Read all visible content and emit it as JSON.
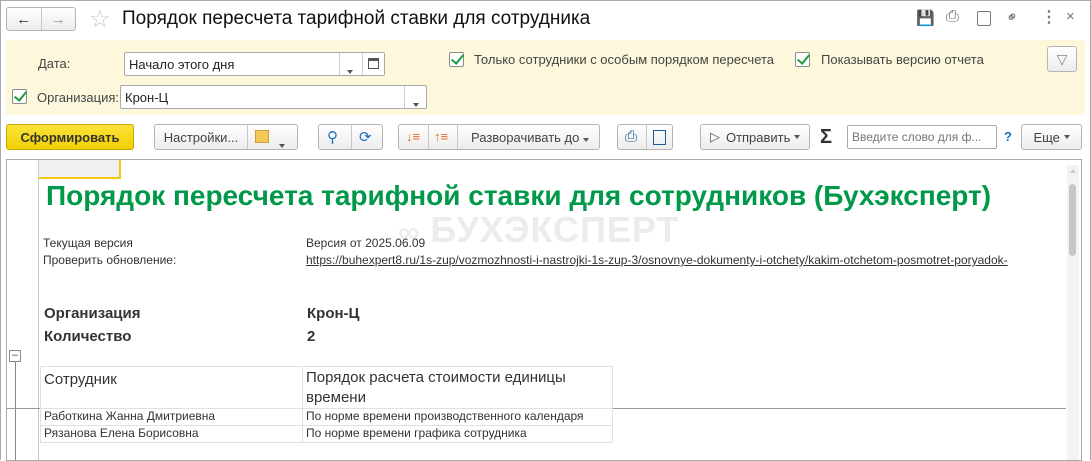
{
  "window": {
    "title": "Порядок пересчета тарифной ставки для сотрудника"
  },
  "filters": {
    "date_label": "Дата:",
    "date_value": "Начало этого дня",
    "org_label": "Организация:",
    "org_value": "Крон-Ц",
    "only_special_label": "Только сотрудники с особым порядком пересчета",
    "show_version_label": "Показывать версию отчета"
  },
  "toolbar": {
    "generate": "Сформировать",
    "settings": "Настройки...",
    "expand_to": "Разворачивать до",
    "send": "Отправить",
    "sigma": "Σ",
    "search_placeholder": "Введите слово для ф...",
    "help": "?",
    "more": "Еще"
  },
  "report": {
    "title": "Порядок пересчета тарифной ставки для сотрудников (Бухэксперт)",
    "watermark": "БУХЭКСПЕРТ",
    "version_label": "Текущая версия",
    "version_value": "Версия от 2025.06.09",
    "update_label": "Проверить обновление:",
    "update_link": "https://buhexpert8.ru/1s-zup/vozmozhnosti-i-nastrojki-1s-zup-3/osnovnye-dokumenty-i-otchety/kakim-otchetom-posmotret-poryadok-",
    "org_label": "Организация",
    "org_value": "Крон-Ц",
    "count_label": "Количество",
    "count_value": "2",
    "columns": [
      "Сотрудник",
      "Порядок расчета стоимости единицы времени"
    ],
    "rows": [
      [
        "Работкина Жанна Дмитриевна",
        "По норме времени производственного календаря"
      ],
      [
        "Рязанова Елена Борисовна",
        "По норме времени графика сотрудника"
      ]
    ]
  },
  "colors": {
    "accent_green": "#00994a",
    "panel_yellow": "#fdf8dc",
    "button_yellow": "#f5d60f"
  }
}
